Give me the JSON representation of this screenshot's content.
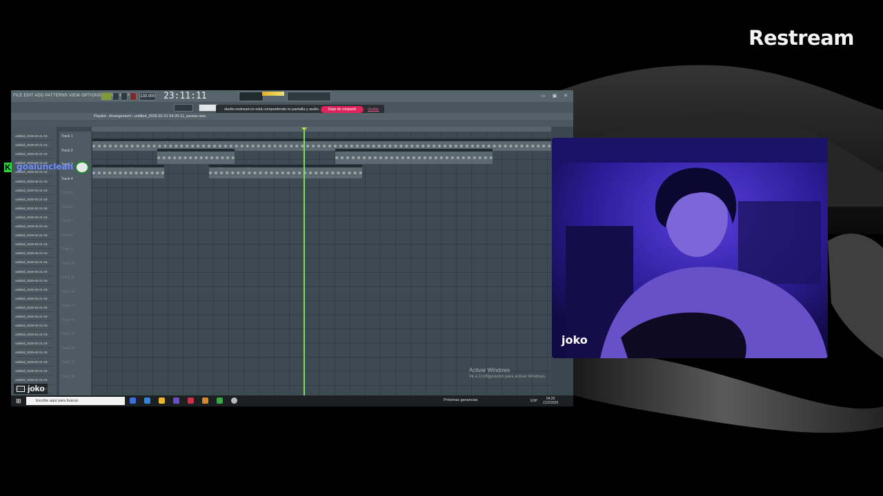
{
  "brand": "Restream",
  "screen_share": {
    "menu": "FILE EDIT ADD PATTERNS VIEW OPTIONS TOOLS HELP",
    "time": "23:11:11",
    "bpm": "130.000",
    "notice_text": "studio.restream.io está compartiendo tu pantalla y audio.",
    "notice_stop": "Dejar de compartir",
    "notice_hide": "Ocultar",
    "playlist_title": "Playlist - Arrangement › untitled_2026-02-21 04-20-11_sarosa new",
    "browser_items": [
      "untitled_2026-02-21 04-",
      "untitled_2026-02-21 04-",
      "untitled_2026-02-21 04-",
      "untitled_2026-02-21 04-",
      "untitled_2026-02-21 04-",
      "untitled_2026-02-21 04-",
      "untitled_2026-02-21 04-",
      "untitled_2026-02-21 04-",
      "untitled_2026-02-21 04-",
      "untitled_2026-02-21 04-",
      "untitled_2026-02-21 04-",
      "untitled_2026-02-21 04-",
      "untitled_2026-02-21 04-",
      "untitled_2026-02-21 04-",
      "untitled_2026-02-21 04-",
      "untitled_2026-02-21 04-",
      "untitled_2026-02-21 04-",
      "untitled_2026-02-21 04-",
      "untitled_2026-02-21 04-",
      "untitled_2026-02-21 04-",
      "untitled_2026-02-21 04-",
      "untitled_2026-02-21 04-",
      "untitled_2026-02-21 04-",
      "untitled_2026-02-21 04-",
      "untitled_2026-02-21 04-",
      "untitled_2026-02-21 04-",
      "untitled_2026-02-21 04-",
      "untitled_2026-02-21 04-",
      "untitled_2026-02-21 04-",
      "untitled_2026-02-21 04-"
    ],
    "tracks": [
      "Track 1",
      "Track 2",
      "Track 3",
      "Track 4",
      "Track 5",
      "Track 6",
      "Track 7",
      "Track 8",
      "Track 9",
      "Track 10",
      "Track 11",
      "Track 12",
      "Track 13",
      "Track 14",
      "Track 15",
      "Track 16",
      "Track 17",
      "Track 18"
    ],
    "clips": {
      "c1": "Dj Bella 3 Retired x Jersey Beat x Hip Hop Instrumental \"Light Beat\" - Soft & Chill Type Beat (Prod by 3D",
      "c2": "untitled_2026-02-21 04-11-37_sarosa new",
      "c3": "untitled_2026-02-21 04-20-11_sarosa new",
      "c4": "untitled_2026-02-21 04-16-18_sarosa new",
      "c5": "untitled_2026-02-21 04-16-17_sarosa new"
    },
    "activate_line1": "Activar Windows",
    "activate_line2": "Ve a Configuración para activar Windows.",
    "search_placeholder": "Escribe aquí para buscar.",
    "news": "Próximas ganancias",
    "lang": "ESP",
    "clock_time": "04:20",
    "clock_date": "21/2/2026"
  },
  "chat": {
    "username": "goaluncleah"
  },
  "screen_share_label": "joko",
  "webcam_label": "joko"
}
